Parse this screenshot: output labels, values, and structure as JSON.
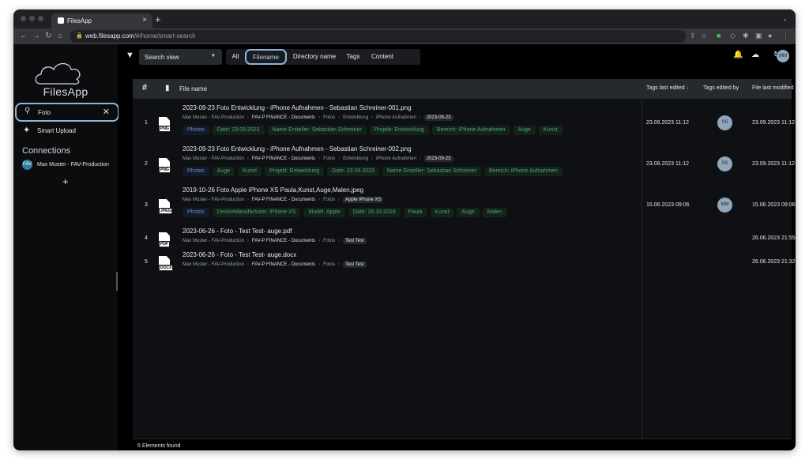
{
  "browser": {
    "tab_title": "FilesApp",
    "tab_close": "×",
    "new_tab": "+",
    "tab_menu": "⌄",
    "url_host": "web.filesapp.com",
    "url_path": "/#/home/smart-search"
  },
  "sidebar": {
    "logo_text": "FilesApp",
    "search_value": "Foto",
    "clear": "✕",
    "smart_upload_label": "Smart Upload",
    "connections_title": "Connections",
    "connection_label": "Max Muster - FAV-Production",
    "connection_avatar": "FAV",
    "add_label": "+"
  },
  "toolbar": {
    "view_select": "Search view",
    "scopes": [
      "All",
      "Filename",
      "Directory name",
      "Tags",
      "Content"
    ],
    "selected_scope": "Filename",
    "user_initials": "MM"
  },
  "table": {
    "headers": {
      "num": "#",
      "name": "File name",
      "tags_edited": "Tags last edited",
      "sort_indicator": "↓",
      "tags_by": "Tags edited by",
      "modified": "File last modified"
    },
    "rows": [
      {
        "num": "1",
        "type": "PNG",
        "name": "2023-09-23 Foto Entwicklung - iPhone Aufnahmen - Sebastian Schreiner-001.png",
        "path": [
          "Max Muster - FAV-Production",
          "FAV-P FINANCE - Documents",
          "Fotos",
          "Entwicklung",
          "iPhone Aufnahmen",
          "2023-09-23"
        ],
        "tags": [
          "Photos",
          "Date: 23.09.2023",
          "Name Ersteller: Sebastian Schreiner",
          "Projekt: Entwicklung",
          "Bereich: iPhone Aufnahmen",
          "Auge",
          "Kunst"
        ],
        "tags_edited": "23.09.2023 11:12",
        "edited_by": "SS",
        "modified": "23.09.2023 11:12"
      },
      {
        "num": "2",
        "type": "PNG",
        "name": "2023-09-23 Foto Entwicklung - iPhone Aufnahmen - Sebastian Schreiner-002.png",
        "path": [
          "Max Muster - FAV-Production",
          "FAV-P FINANCE - Documents",
          "Fotos",
          "Entwicklung",
          "iPhone Aufnahmen",
          "2023-09-23"
        ],
        "tags": [
          "Photos",
          "Auge",
          "Kunst",
          "Projekt: Entwicklung",
          "Date: 23.09.2023",
          "Name Ersteller: Sebastian Schreiner",
          "Bereich: iPhone Aufnahmen"
        ],
        "tags_edited": "23.09.2023 11:12",
        "edited_by": "SS",
        "modified": "23.09.2023 11:12"
      },
      {
        "num": "3",
        "type": "JPEG",
        "name": "2019-10-26 Foto Apple iPhone XS Paula,Kunst,Auge,Malen.jpeg",
        "path": [
          "Max Muster - FAV-Production",
          "FAV-P FINANCE - Documents",
          "Fotos",
          "Apple iPhone XS"
        ],
        "tags": [
          "Photos",
          "DeviceManufacturer: iPhone XS",
          "Model: Apple",
          "Date: 26.10.2019",
          "Paula",
          "Kunst",
          "Auge",
          "Malen"
        ],
        "tags_edited": "15.06.2023 09:06",
        "edited_by": "MM",
        "modified": "15.06.2023 09:06"
      },
      {
        "num": "4",
        "type": "PDF",
        "name": "2023-06-26 - Foto - Test Test- auge.pdf",
        "path": [
          "Max Muster - FAV-Production",
          "FAV-P FINANCE - Documents",
          "Fotos",
          "Test Test"
        ],
        "tags": [],
        "tags_edited": "",
        "edited_by": "",
        "modified": "26.06.2023 21:55"
      },
      {
        "num": "5",
        "type": "DOCX",
        "name": "2023-06-26 - Foto - Test Test- auge.docx",
        "path": [
          "Max Muster - FAV-Production",
          "FAV-P FINANCE - Documents",
          "Fotos",
          "Test Test"
        ],
        "tags": [],
        "tags_edited": "",
        "edited_by": "",
        "modified": "26.06.2023 21:32"
      }
    ]
  },
  "footer": {
    "count_text": "5 Elements found"
  },
  "colors": {
    "accent": "#8fb6da",
    "tag_green": "#55a368",
    "tag_blue": "#6f8cc4",
    "avatar": "#90a6bb"
  }
}
